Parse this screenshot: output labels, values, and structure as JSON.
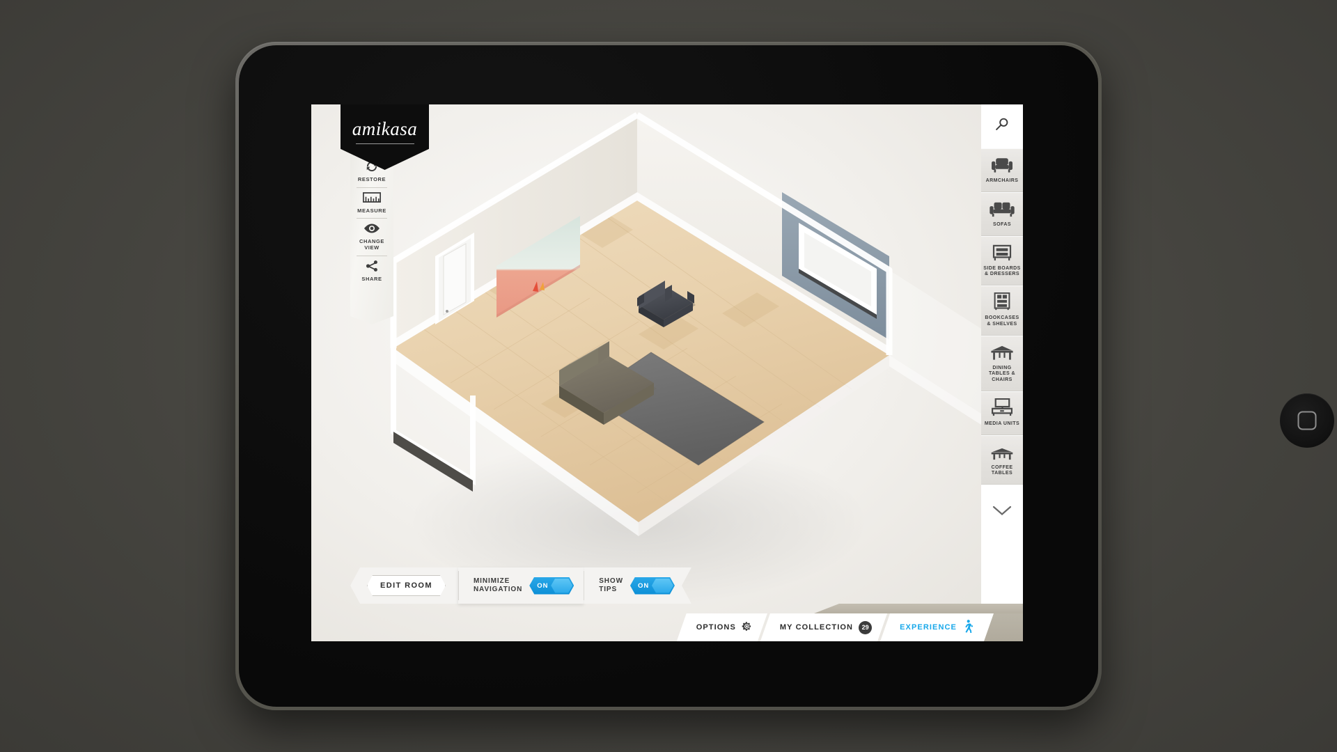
{
  "app": {
    "logo_text": "amikasa"
  },
  "tools": {
    "items": [
      {
        "label": "RESTORE",
        "icon": "restore-icon"
      },
      {
        "label": "MEASURE",
        "icon": "ruler-icon"
      },
      {
        "label": "CHANGE\nVIEW",
        "icon": "eye-icon"
      },
      {
        "label": "SHARE",
        "icon": "share-icon"
      }
    ]
  },
  "sidebar": {
    "search_icon": "search-icon",
    "more_icon": "chevron-down-icon",
    "categories": [
      {
        "label": "ARMCHAIRS",
        "icon": "armchair-icon"
      },
      {
        "label": "SOFAS",
        "icon": "sofa-icon"
      },
      {
        "label": "SIDE\nBOARDS &\nDRESSERS",
        "icon": "dresser-icon"
      },
      {
        "label": "BOOKCASES\n& SHELVES",
        "icon": "bookcase-icon"
      },
      {
        "label": "DINING\nTABLES\n& CHAIRS",
        "icon": "dining-table-icon"
      },
      {
        "label": "MEDIA\nUNITS",
        "icon": "media-unit-icon"
      },
      {
        "label": "COFFEE\nTABLES",
        "icon": "coffee-table-icon"
      }
    ]
  },
  "bottom_left": {
    "edit_room_label": "EDIT ROOM",
    "minimize_navigation": {
      "label": "MINIMIZE\nNAVIGATION",
      "value": "ON"
    },
    "show_tips": {
      "label": "SHOW\nTIPS",
      "value": "ON"
    }
  },
  "bottom_right": {
    "options_label": "OPTIONS",
    "options_icon": "gear-icon",
    "collection_label": "MY COLLECTION",
    "collection_count": "29",
    "experience_label": "EXPERIENCE",
    "experience_icon": "walking-person-icon"
  },
  "colors": {
    "accent_blue": "#18a8ea",
    "toggle_blue": "#0c8fd6",
    "logo_black": "#0d0d0d",
    "tan_strip": "#b6b0a2"
  }
}
